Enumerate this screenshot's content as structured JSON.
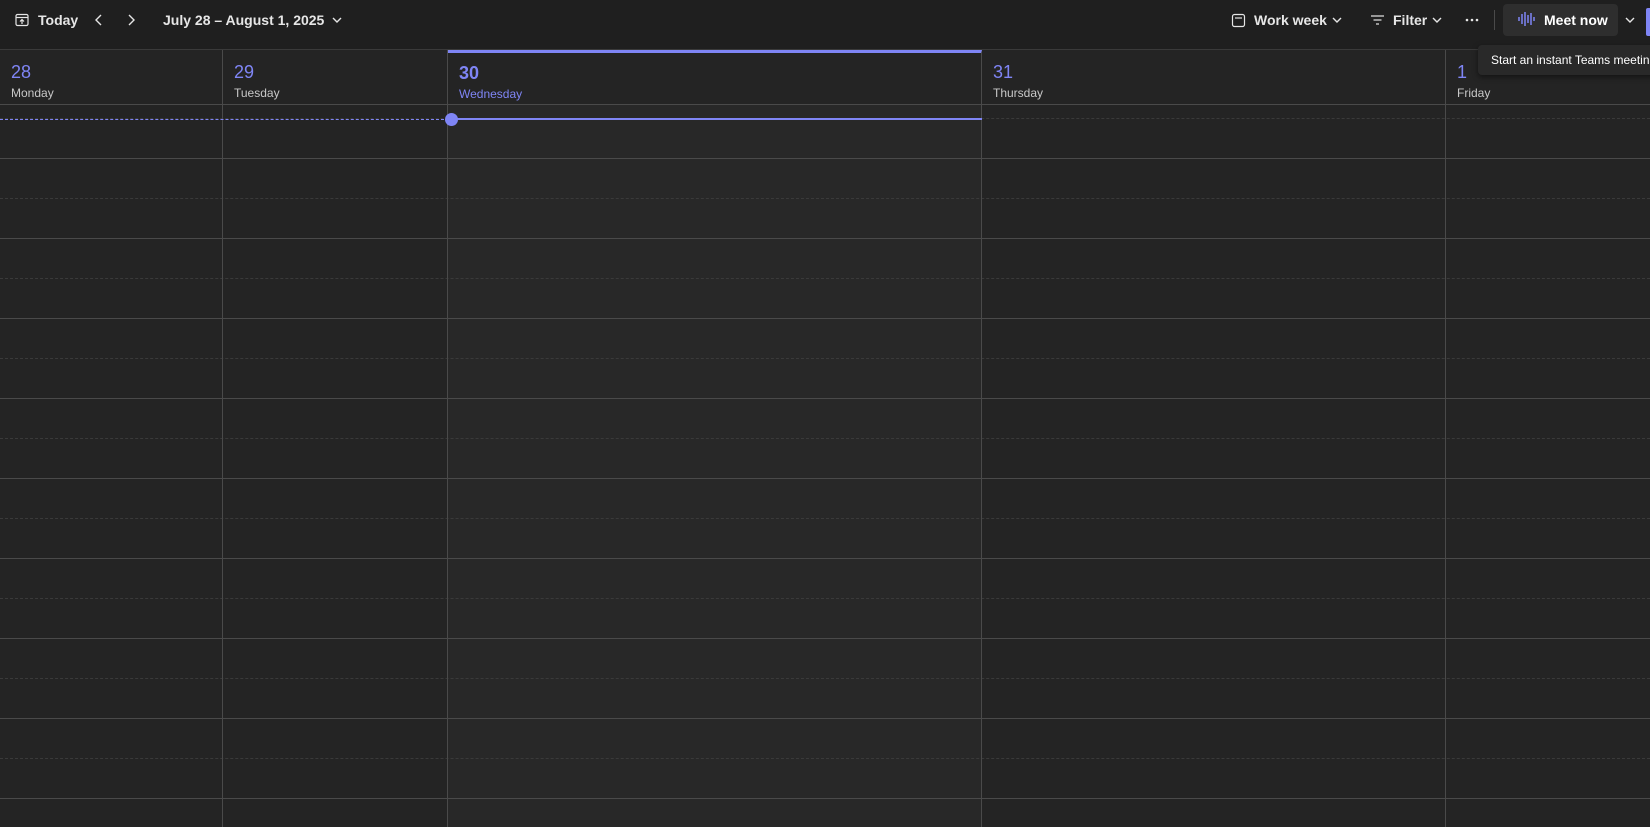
{
  "toolbar": {
    "today_label": "Today",
    "date_range": "July 28 – August 1, 2025",
    "view_label": "Work week",
    "filter_label": "Filter",
    "meet_now_label": "Meet now"
  },
  "tooltip": {
    "text": "Start an instant Teams meeting"
  },
  "days": [
    {
      "num": "28",
      "name": "Monday"
    },
    {
      "num": "29",
      "name": "Tuesday"
    },
    {
      "num": "30",
      "name": "Wednesday"
    },
    {
      "num": "31",
      "name": "Thursday"
    },
    {
      "num": "1",
      "name": "Friday"
    }
  ],
  "colors": {
    "accent": "#7f85f5",
    "background": "#242424",
    "toolbar": "#1f1f1f"
  }
}
